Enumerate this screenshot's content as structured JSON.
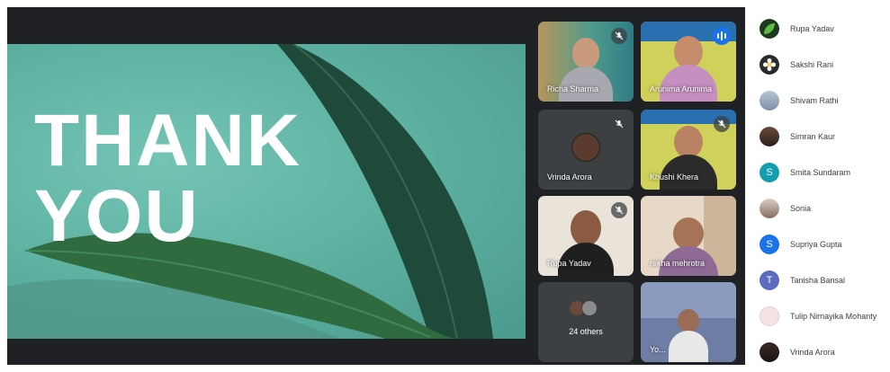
{
  "slide": {
    "line1": "THANK",
    "line2": "YOU"
  },
  "tiles": [
    {
      "name": "Richa Sharma",
      "muted": true
    },
    {
      "name": "Arunima Arunima",
      "speaking": true
    },
    {
      "name": "Vrinda Arora",
      "muted": true
    },
    {
      "name": "Khushi Khera",
      "muted": true
    },
    {
      "name": "Rupa Yadav",
      "muted": true
    },
    {
      "name": "rekha mehrotra"
    },
    {
      "name": "24 others"
    },
    {
      "name": "Yo..."
    }
  ],
  "participants": [
    {
      "name": "Rupa Yadav",
      "avatar": "leaf-photo"
    },
    {
      "name": "Sakshi Rani",
      "avatar": "flower-photo"
    },
    {
      "name": "Shivam Rathi",
      "avatar": "photo"
    },
    {
      "name": "Simran Kaur",
      "avatar": "photo"
    },
    {
      "name": "Smita Sundaram",
      "initial": "S",
      "color": "#129eaf"
    },
    {
      "name": "Sonia",
      "avatar": "photo"
    },
    {
      "name": "Supriya Gupta",
      "initial": "S",
      "color": "#1a73e8"
    },
    {
      "name": "Tanisha Bansal",
      "initial": "T",
      "color": "#5c6bc0"
    },
    {
      "name": "Tulip Nirnayika Mohanty",
      "avatar": "photo"
    },
    {
      "name": "Vrinda Arora",
      "avatar": "photo"
    }
  ],
  "colors": {
    "stage": "#202124",
    "tile": "#3c4043",
    "speaking": "#8ab4f8",
    "slide_green": "#5fb3a3"
  }
}
